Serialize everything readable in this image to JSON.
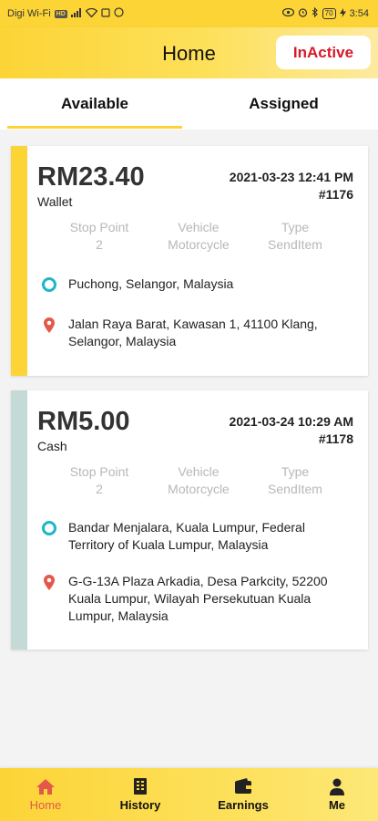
{
  "status_bar": {
    "carrier": "Digi Wi-Fi",
    "network_badge": "HD",
    "battery": "70",
    "time": "3:54"
  },
  "header": {
    "title": "Home",
    "status_button": "InActive"
  },
  "tabs": [
    {
      "label": "Available",
      "active": true
    },
    {
      "label": "Assigned",
      "active": false
    }
  ],
  "orders": [
    {
      "amount": "RM23.40",
      "payment": "Wallet",
      "datetime": "2021-03-23 12:41 PM",
      "order_no": "#1176",
      "meta": [
        {
          "label": "Stop Point",
          "value": "2"
        },
        {
          "label": "Vehicle",
          "value": "Motorcycle"
        },
        {
          "label": "Type",
          "value": "SendItem"
        }
      ],
      "pickup": "Puchong, Selangor, Malaysia",
      "dropoff": "Jalan Raya Barat, Kawasan 1, 41100 Klang, Selangor, Malaysia",
      "accent_color": "#fcd436"
    },
    {
      "amount": "RM5.00",
      "payment": "Cash",
      "datetime": "2021-03-24 10:29 AM",
      "order_no": "#1178",
      "meta": [
        {
          "label": "Stop Point",
          "value": "2"
        },
        {
          "label": "Vehicle",
          "value": "Motorcycle"
        },
        {
          "label": "Type",
          "value": "SendItem"
        }
      ],
      "pickup": "Bandar Menjalara, Kuala Lumpur, Federal Territory of Kuala Lumpur, Malaysia",
      "dropoff": "G-G-13A Plaza Arkadia, Desa Parkcity, 52200 Kuala Lumpur, Wilayah Persekutuan Kuala Lumpur, Malaysia",
      "accent_color": "#c3dad7"
    }
  ],
  "bottom_nav": [
    {
      "label": "Home",
      "icon": "home-icon",
      "active": true
    },
    {
      "label": "History",
      "icon": "history-icon",
      "active": false
    },
    {
      "label": "Earnings",
      "icon": "wallet-icon",
      "active": false
    },
    {
      "label": "Me",
      "icon": "person-icon",
      "active": false
    }
  ],
  "colors": {
    "brand_yellow": "#fcd436",
    "inactive_red": "#d8192a",
    "pickup_teal": "#1fb6c8",
    "dropoff_orange": "#e3584b"
  }
}
